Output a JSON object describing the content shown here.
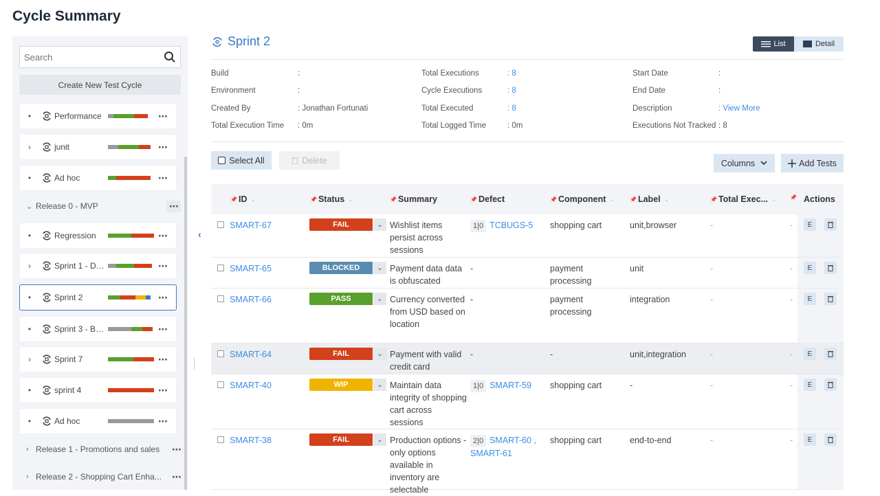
{
  "page": {
    "title": "Cycle Summary"
  },
  "sidebar": {
    "search_placeholder": "Search",
    "create_label": "Create New Test Cycle",
    "cycles": [
      {
        "label": "Performance",
        "prefix": "•",
        "bar": [
          [
            "#9a9a9a",
            0.12
          ],
          [
            "#5aa02c",
            0.45
          ],
          [
            "#d2411b",
            0.3
          ]
        ]
      },
      {
        "label": "junit",
        "prefix": "›",
        "bar": [
          [
            "#9a9a9a",
            0.22
          ],
          [
            "#5aa02c",
            0.45
          ],
          [
            "#d2411b",
            0.25
          ]
        ]
      },
      {
        "label": "Ad hoc",
        "prefix": "•",
        "bar": [
          [
            "#5aa02c",
            0.18
          ],
          [
            "#d2411b",
            0.74
          ]
        ]
      },
      {
        "label": "Regression",
        "prefix": "•",
        "bar": [
          [
            "#5aa02c",
            0.5
          ],
          [
            "#d2411b",
            0.5
          ]
        ]
      },
      {
        "label": "Sprint 1 - Dep...",
        "prefix": "›",
        "bar": [
          [
            "#9a9a9a",
            0.18
          ],
          [
            "#5aa02c",
            0.38
          ],
          [
            "#d2411b",
            0.4
          ]
        ]
      },
      {
        "label": "Sprint 2",
        "prefix": "•",
        "bar": [
          [
            "#5aa02c",
            0.25
          ],
          [
            "#d2411b",
            0.35
          ],
          [
            "#f0b400",
            0.22
          ],
          [
            "#3a78c8",
            0.1
          ]
        ]
      },
      {
        "label": "Sprint 3 - Bas...",
        "prefix": "•",
        "bar": [
          [
            "#9a9a9a",
            0.5
          ],
          [
            "#5aa02c",
            0.25
          ],
          [
            "#d2411b",
            0.22
          ]
        ]
      },
      {
        "label": "Sprint 7",
        "prefix": "›",
        "bar": [
          [
            "#5aa02c",
            0.55
          ],
          [
            "#d2411b",
            0.45
          ]
        ]
      },
      {
        "label": "sprint 4",
        "prefix": "•",
        "bar": [
          [
            "#d2411b",
            1.0
          ]
        ]
      },
      {
        "label": "Ad hoc",
        "prefix": "•",
        "bar": [
          [
            "#9a9a9a",
            1.0
          ]
        ]
      }
    ],
    "releases": [
      {
        "label": "Release 0 - MVP",
        "chev": "⌄"
      },
      {
        "label": "Release 1 - Promotions and sales",
        "chev": "›"
      },
      {
        "label": "Release 2 - Shopping Cart Enha...",
        "chev": "›"
      }
    ]
  },
  "header": {
    "cycle_name": "Sprint 2",
    "list_label": "List",
    "detail_label": "Detail"
  },
  "meta": {
    "build_label": "Build",
    "build_value": ":",
    "environment_label": "Environment",
    "environment_value": ":",
    "created_by_label": "Created By",
    "created_by_value": ": Jonathan Fortunati",
    "total_exec_time_label": "Total Execution Time",
    "total_exec_time_value": ": 0m",
    "total_executions_label": "Total Executions",
    "total_executions_value": ": 8",
    "cycle_executions_label": "Cycle Executions",
    "cycle_executions_value": ": 8",
    "total_executed_label": "Total Executed",
    "total_executed_value": ": 8",
    "total_logged_time_label": "Total Logged Time",
    "total_logged_time_value": ": 0m",
    "start_date_label": "Start Date",
    "start_date_value": ":",
    "end_date_label": "End Date",
    "end_date_value": ":",
    "description_label": "Description",
    "description_value": ": View More",
    "not_tracked_label": "Executions Not Tracked",
    "not_tracked_value": ": 8"
  },
  "toolbar": {
    "select_all": "Select All",
    "delete": "Delete",
    "columns": "Columns",
    "add_tests": "Add Tests"
  },
  "table": {
    "headers": {
      "id": "ID",
      "status": "Status",
      "summary": "Summary",
      "defect": "Defect",
      "component": "Component",
      "label": "Label",
      "total_exec": "Total Exec...",
      "actions": "Actions"
    },
    "rows": [
      {
        "id": "SMART-67",
        "status": "FAIL",
        "status_color": "#d2411b",
        "summary": "Wishlist items persist across sessions",
        "defect_count": "1|0",
        "defects": "TCBUGS-5",
        "component": "shopping cart",
        "label": "unit,browser",
        "total_exec": "-",
        "extra": "-"
      },
      {
        "id": "SMART-65",
        "status": "BLOCKED",
        "status_color": "#5a8bb0",
        "summary": "Payment data data is obfuscated",
        "defect_count": "",
        "defects": "-",
        "component": "payment processing",
        "label": "unit",
        "total_exec": "-",
        "extra": "-"
      },
      {
        "id": "SMART-66",
        "status": "PASS",
        "status_color": "#5aa02c",
        "summary": "Currency converted from USD based on location",
        "defect_count": "",
        "defects": "-",
        "component": "payment processing",
        "label": "integration",
        "total_exec": "-",
        "extra": "-"
      },
      {
        "id": "SMART-64",
        "status": "FAIL",
        "status_color": "#d2411b",
        "summary": "Payment with valid credit card",
        "defect_count": "",
        "defects": "-",
        "component": "-",
        "label": "unit,integration",
        "total_exec": "-",
        "extra": "-"
      },
      {
        "id": "SMART-40",
        "status": "WIP",
        "status_color": "#f0b400",
        "summary": "Maintain data integrity of shopping cart across sessions",
        "defect_count": "1|0",
        "defects": "SMART-59",
        "component": "shopping cart",
        "label": "-",
        "total_exec": "-",
        "extra": "-"
      },
      {
        "id": "SMART-38",
        "status": "FAIL",
        "status_color": "#d2411b",
        "summary": "Production options - only options available in inventory are selectable",
        "defect_count": "2|0",
        "defects": "SMART-60 , SMART-61",
        "component": "shopping cart",
        "label": "end-to-end",
        "total_exec": "-",
        "extra": "-"
      }
    ]
  }
}
